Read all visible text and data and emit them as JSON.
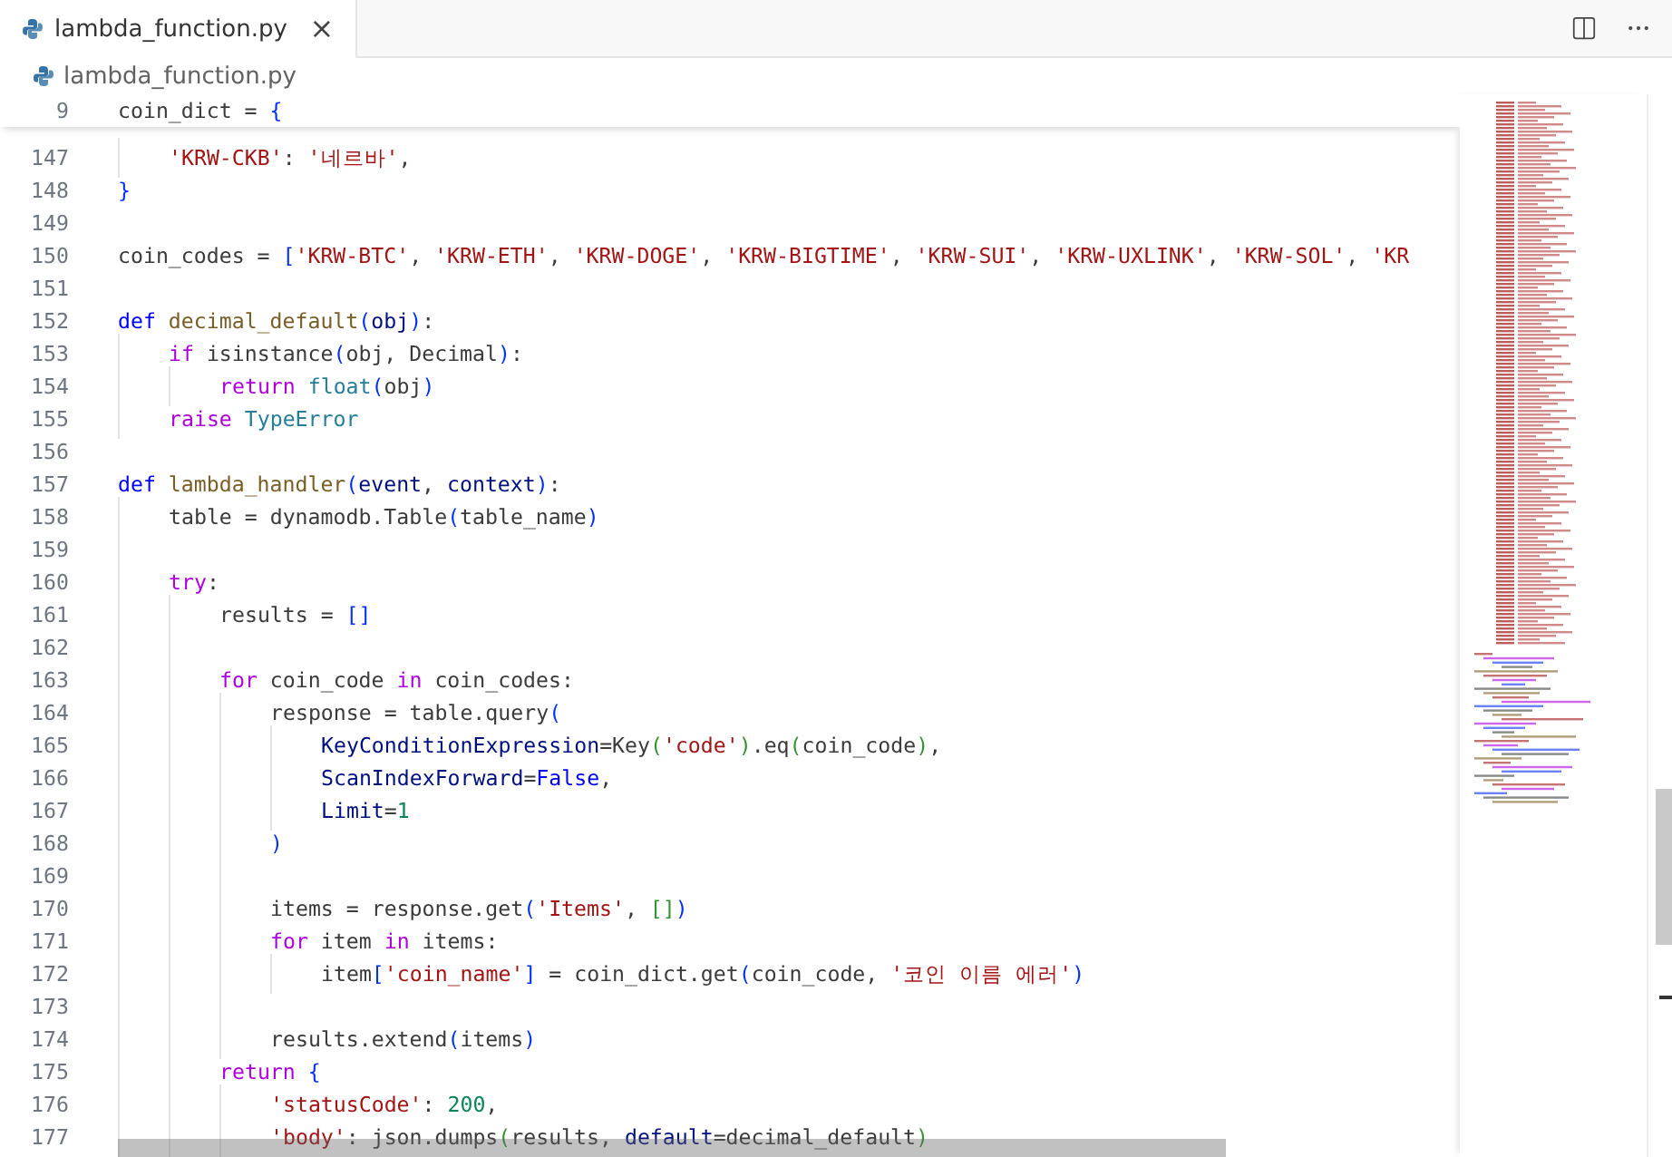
{
  "tab": {
    "label": "lambda_function.py",
    "selected": true,
    "close": "×"
  },
  "breadcrumb": {
    "label": "lambda_function.py"
  },
  "sticky": {
    "number": "9",
    "tokens": [
      {
        "t": "coin_dict =",
        "color": "#3b3b3b"
      },
      {
        "t": " {",
        "color": "#0431fa"
      }
    ],
    "children": [
      {
        "number": "147",
        "tokens": [
          {
            "t": "'KRW-CKB'",
            "color": "#a31515"
          },
          {
            "t": ":",
            "color": "#3b3b3b"
          },
          {
            "t": " '네르바'",
            "color": "#a31515"
          },
          {
            "t": ",",
            "color": "#3b3b3b"
          }
        ]
      }
    ]
  },
  "lines": [
    {
      "number": "148",
      "tokens": [
        {
          "t": "}",
          "color": "#0431fa"
        }
      ]
    },
    {
      "number": "149"
    },
    {
      "number": "150",
      "tokens": [
        {
          "t": "coin_codes =",
          "color": "#3b3b3b"
        },
        {
          "t": " [",
          "color": "#0431fa"
        },
        {
          "t": "'KRW-BTC'",
          "color": "#a31515"
        },
        {
          "t": ",",
          "color": "#3b3b3b"
        },
        {
          "t": " 'KRW-ETH'",
          "color": "#a31515"
        },
        {
          "t": ",",
          "color": "#3b3b3b"
        },
        {
          "t": " 'KRW-DOGE'",
          "color": "#a31515"
        },
        {
          "t": ",",
          "color": "#3b3b3b"
        },
        {
          "t": " 'KRW-BIGTIME'",
          "color": "#a31515"
        },
        {
          "t": ",",
          "color": "#3b3b3b"
        },
        {
          "t": " 'KRW-SUI'",
          "color": "#a31515"
        },
        {
          "t": ",",
          "color": "#3b3b3b"
        },
        {
          "t": " 'KRW-UXLINK'",
          "color": "#a31515"
        },
        {
          "t": ",",
          "color": "#3b3b3b"
        },
        {
          "t": " 'KRW-SOL'",
          "color": "#a31515"
        },
        {
          "t": ",",
          "color": "#3b3b3b"
        },
        {
          "t": " 'KR",
          "color": "#a31515"
        }
      ]
    },
    {
      "number": "151"
    },
    {
      "number": "152",
      "tokens": [
        {
          "t": "def",
          "color": "#0000ff"
        },
        {
          "t": " decimal_default",
          "color": "#795e26"
        },
        {
          "t": "(",
          "color": "#0431fa"
        },
        {
          "t": "obj",
          "color": "#001080"
        },
        {
          "t": ")",
          "color": "#0431fa"
        },
        {
          "t": ":",
          "color": "#3b3b3b"
        }
      ],
      "children": [
        {
          "number": "153",
          "tokens": [
            {
              "t": "if",
              "color": "#af00db"
            },
            {
              "t": " isinstance",
              "color": "#3b3b3b"
            },
            {
              "t": "(",
              "color": "#0431fa"
            },
            {
              "t": "obj, Decimal",
              "color": "#3b3b3b"
            },
            {
              "t": ")",
              "color": "#0431fa"
            },
            {
              "t": ":",
              "color": "#3b3b3b"
            }
          ],
          "children": [
            {
              "number": "154",
              "tokens": [
                {
                  "t": "return",
                  "color": "#af00db"
                },
                {
                  "t": " float",
                  "color": "#267f99"
                },
                {
                  "t": "(",
                  "color": "#0431fa"
                },
                {
                  "t": "obj",
                  "color": "#3b3b3b"
                },
                {
                  "t": ")",
                  "color": "#0431fa"
                }
              ]
            }
          ]
        },
        {
          "number": "155",
          "tokens": [
            {
              "t": "raise",
              "color": "#af00db"
            },
            {
              "t": " TypeError",
              "color": "#267f99"
            }
          ]
        }
      ]
    },
    {
      "number": "156"
    },
    {
      "number": "157",
      "tokens": [
        {
          "t": "def",
          "color": "#0000ff"
        },
        {
          "t": " lambda_handler",
          "color": "#795e26"
        },
        {
          "t": "(",
          "color": "#0431fa"
        },
        {
          "t": "event",
          "color": "#001080"
        },
        {
          "t": ",",
          "color": "#3b3b3b"
        },
        {
          "t": " context",
          "color": "#001080"
        },
        {
          "t": ")",
          "color": "#0431fa"
        },
        {
          "t": ":",
          "color": "#3b3b3b"
        }
      ],
      "children": [
        {
          "number": "158",
          "tokens": [
            {
              "t": "table = dynamodb.Table",
              "color": "#3b3b3b"
            },
            {
              "t": "(",
              "color": "#0431fa"
            },
            {
              "t": "table_name",
              "color": "#3b3b3b"
            },
            {
              "t": ")",
              "color": "#0431fa"
            }
          ]
        },
        {
          "number": "159"
        },
        {
          "number": "160",
          "tokens": [
            {
              "t": "try",
              "color": "#af00db"
            },
            {
              "t": ":",
              "color": "#3b3b3b"
            }
          ],
          "children": [
            {
              "number": "161",
              "tokens": [
                {
                  "t": "results =",
                  "color": "#3b3b3b"
                },
                {
                  "t": " []",
                  "color": "#0431fa"
                }
              ]
            },
            {
              "number": "162"
            },
            {
              "number": "163",
              "tokens": [
                {
                  "t": "for",
                  "color": "#af00db"
                },
                {
                  "t": " coin_code",
                  "color": "#3b3b3b"
                },
                {
                  "t": " in",
                  "color": "#af00db"
                },
                {
                  "t": " coin_codes:",
                  "color": "#3b3b3b"
                }
              ],
              "children": [
                {
                  "number": "164",
                  "tokens": [
                    {
                      "t": "response = table.query",
                      "color": "#3b3b3b"
                    },
                    {
                      "t": "(",
                      "color": "#0431fa"
                    }
                  ],
                  "children": [
                    {
                      "number": "165",
                      "tokens": [
                        {
                          "t": "KeyConditionExpression",
                          "color": "#001080"
                        },
                        {
                          "t": "=Key",
                          "color": "#3b3b3b"
                        },
                        {
                          "t": "(",
                          "color": "#319331"
                        },
                        {
                          "t": "'code'",
                          "color": "#a31515"
                        },
                        {
                          "t": ")",
                          "color": "#319331"
                        },
                        {
                          "t": ".eq",
                          "color": "#3b3b3b"
                        },
                        {
                          "t": "(",
                          "color": "#319331"
                        },
                        {
                          "t": "coin_code",
                          "color": "#3b3b3b"
                        },
                        {
                          "t": ")",
                          "color": "#319331"
                        },
                        {
                          "t": ",",
                          "color": "#3b3b3b"
                        }
                      ]
                    },
                    {
                      "number": "166",
                      "tokens": [
                        {
                          "t": "ScanIndexForward",
                          "color": "#001080"
                        },
                        {
                          "t": "=",
                          "color": "#3b3b3b"
                        },
                        {
                          "t": "False",
                          "color": "#0000ff"
                        },
                        {
                          "t": ",",
                          "color": "#3b3b3b"
                        }
                      ]
                    },
                    {
                      "number": "167",
                      "tokens": [
                        {
                          "t": "Limit",
                          "color": "#001080"
                        },
                        {
                          "t": "=",
                          "color": "#3b3b3b"
                        },
                        {
                          "t": "1",
                          "color": "#098658"
                        }
                      ]
                    }
                  ]
                },
                {
                  "number": "168",
                  "tokens": [
                    {
                      "t": ")",
                      "color": "#0431fa"
                    }
                  ]
                },
                {
                  "number": "169"
                },
                {
                  "number": "170",
                  "tokens": [
                    {
                      "t": "items = response.get",
                      "color": "#3b3b3b"
                    },
                    {
                      "t": "(",
                      "color": "#0431fa"
                    },
                    {
                      "t": "'Items'",
                      "color": "#a31515"
                    },
                    {
                      "t": ",",
                      "color": "#3b3b3b"
                    },
                    {
                      "t": " []",
                      "color": "#319331"
                    },
                    {
                      "t": ")",
                      "color": "#0431fa"
                    }
                  ]
                },
                {
                  "number": "171",
                  "tokens": [
                    {
                      "t": "for",
                      "color": "#af00db"
                    },
                    {
                      "t": " item",
                      "color": "#3b3b3b"
                    },
                    {
                      "t": " in",
                      "color": "#af00db"
                    },
                    {
                      "t": " items:",
                      "color": "#3b3b3b"
                    }
                  ],
                  "children": [
                    {
                      "number": "172",
                      "tokens": [
                        {
                          "t": "item",
                          "color": "#3b3b3b"
                        },
                        {
                          "t": "[",
                          "color": "#0431fa"
                        },
                        {
                          "t": "'coin_name'",
                          "color": "#a31515"
                        },
                        {
                          "t": "]",
                          "color": "#0431fa"
                        },
                        {
                          "t": " = coin_dict.get",
                          "color": "#3b3b3b"
                        },
                        {
                          "t": "(",
                          "color": "#0431fa"
                        },
                        {
                          "t": "coin_code,",
                          "color": "#3b3b3b"
                        },
                        {
                          "t": " '코인 이름 에러'",
                          "color": "#a31515"
                        },
                        {
                          "t": ")",
                          "color": "#0431fa"
                        }
                      ]
                    }
                  ]
                },
                {
                  "number": "173"
                },
                {
                  "number": "174",
                  "tokens": [
                    {
                      "t": "results.extend",
                      "color": "#3b3b3b"
                    },
                    {
                      "t": "(",
                      "color": "#0431fa"
                    },
                    {
                      "t": "items",
                      "color": "#3b3b3b"
                    },
                    {
                      "t": ")",
                      "color": "#0431fa"
                    }
                  ]
                }
              ]
            },
            {
              "number": "175",
              "tokens": [
                {
                  "t": "return",
                  "color": "#af00db"
                },
                {
                  "t": " {",
                  "color": "#0431fa"
                }
              ],
              "children": [
                {
                  "number": "176",
                  "tokens": [
                    {
                      "t": "'statusCode'",
                      "color": "#a31515"
                    },
                    {
                      "t": ":",
                      "color": "#3b3b3b"
                    },
                    {
                      "t": " 200",
                      "color": "#098658"
                    },
                    {
                      "t": ",",
                      "color": "#3b3b3b"
                    }
                  ]
                },
                {
                  "number": "177",
                  "tokens": [
                    {
                      "t": "'body'",
                      "color": "#a31515"
                    },
                    {
                      "t": ": json.dumps",
                      "color": "#3b3b3b"
                    },
                    {
                      "t": "(",
                      "color": "#319331"
                    },
                    {
                      "t": "results,",
                      "color": "#3b3b3b"
                    },
                    {
                      "t": " default",
                      "color": "#001080"
                    },
                    {
                      "t": "=decimal_default",
                      "color": "#3b3b3b"
                    },
                    {
                      "t": ")",
                      "color": "#319331"
                    }
                  ]
                }
              ]
            }
          ]
        }
      ]
    }
  ]
}
